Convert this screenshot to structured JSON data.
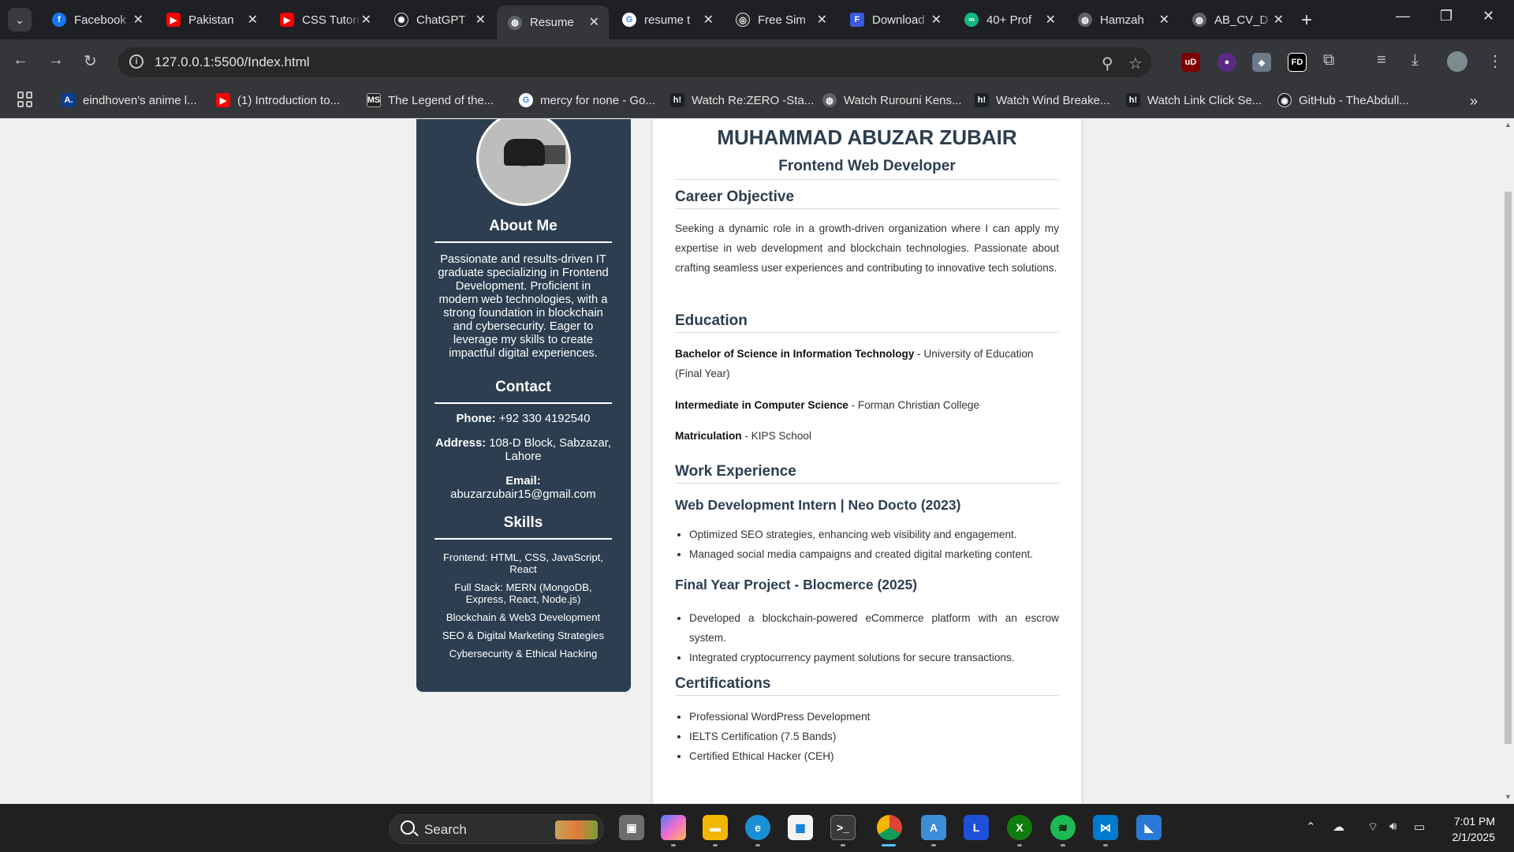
{
  "tabs": [
    {
      "title": "Facebook",
      "fav": "f",
      "color": "#1877f2"
    },
    {
      "title": "Pakistan",
      "fav": "▶",
      "color": "#ff0000"
    },
    {
      "title": "CSS Tutorial",
      "fav": "▶",
      "color": "#ff0000"
    },
    {
      "title": "ChatGPT",
      "fav": "✺",
      "color": "#1f2024"
    },
    {
      "title": "Resume",
      "fav": "◍",
      "color": "#5f6368",
      "active": true
    },
    {
      "title": "resume t",
      "fav": "G",
      "color": "#ffffff"
    },
    {
      "title": "Free Sim",
      "fav": "◎",
      "color": "#2b2b2b"
    },
    {
      "title": "Download",
      "fav": "F",
      "color": "#3b5bdb"
    },
    {
      "title": "40+ Prof",
      "fav": "∞",
      "color": "#10b981"
    },
    {
      "title": "Hamzah",
      "fav": "◍",
      "color": "#5f6368"
    },
    {
      "title": "AB_CV_D",
      "fav": "◍",
      "color": "#5f6368"
    }
  ],
  "address": {
    "url": "127.0.0.1:5500/Index.html"
  },
  "extensions": [
    {
      "name": "ublock-icon",
      "text": "uD",
      "color": "#800000"
    },
    {
      "name": "extension-globe-icon",
      "text": "●",
      "color": "#5b2a86"
    },
    {
      "name": "shield-extension-icon",
      "text": "◈",
      "color": "#6c7a89"
    },
    {
      "name": "fd-extension-icon",
      "text": "FD",
      "color": "#000000"
    }
  ],
  "bookmarks": [
    {
      "label": "eindhoven's anime l...",
      "fav": "A.",
      "color": "#0b3d91"
    },
    {
      "label": "(1) Introduction to...",
      "fav": "▶",
      "color": "#ff0000"
    },
    {
      "label": "The Legend of the...",
      "fav": "MS",
      "color": "#222222"
    },
    {
      "label": "mercy for none - Go...",
      "fav": "G",
      "color": "#ffffff"
    },
    {
      "label": "Watch Re:ZERO -Sta...",
      "fav": "h!",
      "color": "#1d1f27"
    },
    {
      "label": "Watch Rurouni Kens...",
      "fav": "◍",
      "color": "#5f6368"
    },
    {
      "label": "Watch Wind Breake...",
      "fav": "h!",
      "color": "#1d1f27"
    },
    {
      "label": "Watch Link Click Se...",
      "fav": "h!",
      "color": "#1d1f27"
    },
    {
      "label": "GitHub - TheAbdull...",
      "fav": "◉",
      "color": "#1f2024"
    }
  ],
  "sidebar": {
    "about_title": "About Me",
    "about_text": "Passionate and results-driven IT graduate specializing in Frontend Development. Proficient in modern web technologies, with a strong foundation in blockchain and cybersecurity. Eager to leverage my skills to create impactful digital experiences.",
    "contact_title": "Contact",
    "phone_label": "Phone:",
    "phone": "+92 330 4192540",
    "address_label": "Address:",
    "address": "108-D Block, Sabzazar, Lahore",
    "email_label": "Email:",
    "email": "abuzarzubair15@gmail.com",
    "skills_title": "Skills",
    "skills": [
      "Frontend: HTML, CSS, JavaScript, React",
      "Full Stack: MERN (MongoDB, Express, React, Node.js)",
      "Blockchain & Web3 Development",
      "SEO & Digital Marketing Strategies",
      "Cybersecurity & Ethical Hacking"
    ]
  },
  "resume": {
    "name": "MUHAMMAD ABUZAR ZUBAIR",
    "role": "Frontend Web Developer",
    "objective_title": "Career Objective",
    "objective": "Seeking a dynamic role in a growth-driven organization where I can apply my expertise in web development and blockchain technologies. Passionate about crafting seamless user experiences and contributing to innovative tech solutions.",
    "education_title": "Education",
    "education": [
      {
        "degree": "Bachelor of Science in Information Technology",
        "rest": " - University of Education (Final Year)"
      },
      {
        "degree": "Intermediate in Computer Science",
        "rest": " - Forman Christian College"
      },
      {
        "degree": "Matriculation",
        "rest": " - KIPS School"
      }
    ],
    "work_title": "Work Experience",
    "job1_title": "Web Development Intern | Neo Docto (2023)",
    "job1_points": [
      "Optimized SEO strategies, enhancing web visibility and engagement.",
      "Managed social media campaigns and created digital marketing content."
    ],
    "job2_title": "Final Year Project - Blocmerce (2025)",
    "job2_points": [
      "Developed a blockchain-powered eCommerce platform with an escrow system.",
      "Integrated cryptocurrency payment solutions for secure transactions."
    ],
    "cert_title": "Certifications",
    "certs": [
      "Professional WordPress Development",
      "IELTS Certification (7.5 Bands)",
      "Certified Ethical Hacker (CEH)"
    ]
  },
  "taskbar": {
    "search_label": "Search",
    "apps": [
      {
        "name": "file-explorer-icon",
        "color": "#f2b705",
        "text": "▬"
      },
      {
        "name": "edge-icon",
        "color": "#1a8fd6",
        "text": "e"
      },
      {
        "name": "store-icon",
        "color": "#f3f3f3",
        "text": "▦"
      },
      {
        "name": "terminal-icon",
        "color": "#3a3a3a",
        "text": ">_"
      },
      {
        "name": "chrome-icon",
        "color": "#db4437",
        "text": "●"
      },
      {
        "name": "visual-studio-installer-icon",
        "color": "#3c8dd8",
        "text": "A"
      },
      {
        "name": "l-app-icon",
        "color": "#1f4fd6",
        "text": "L"
      },
      {
        "name": "xbox-icon",
        "color": "#107c10",
        "text": "X"
      },
      {
        "name": "spotify-icon",
        "color": "#1db954",
        "text": "≋"
      },
      {
        "name": "vscode-icon",
        "color": "#007acc",
        "text": "⋈"
      },
      {
        "name": "azure-icon",
        "color": "#2a7ad5",
        "text": "◣"
      }
    ],
    "time": "7:01 PM",
    "date": "2/1/2025"
  }
}
